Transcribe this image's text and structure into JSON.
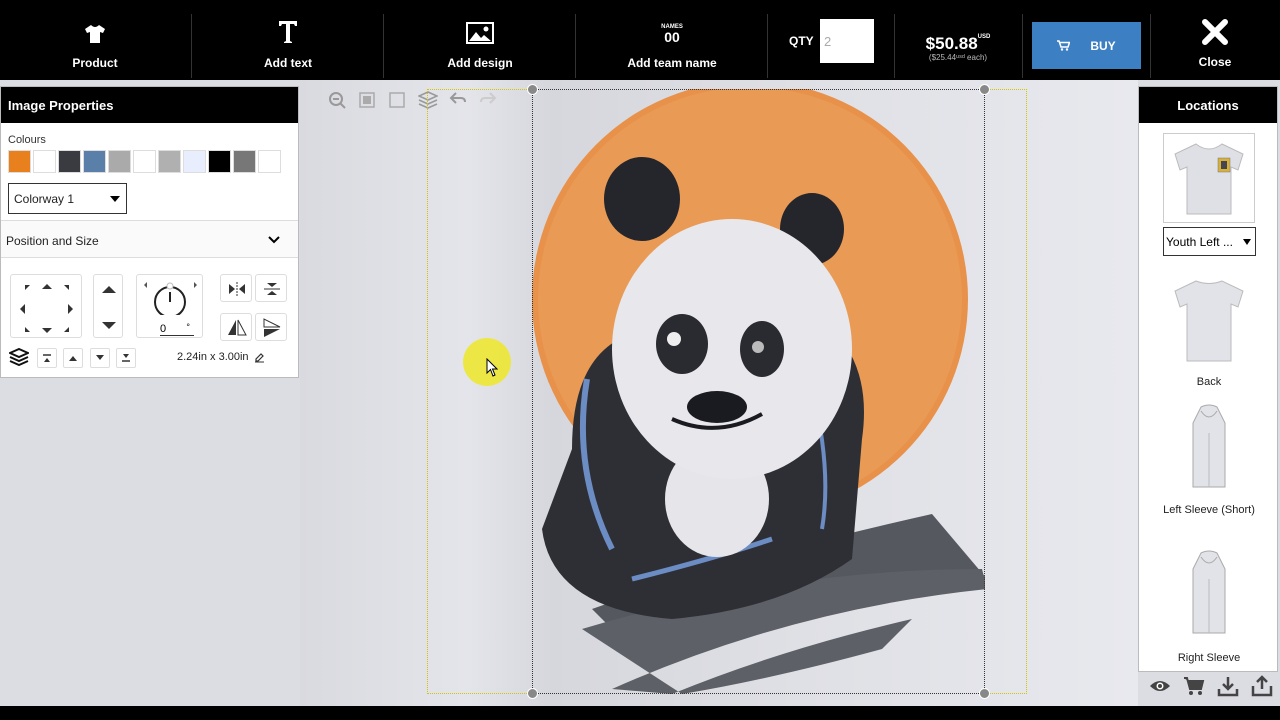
{
  "topbar": {
    "product_label": "Product",
    "add_text_label": "Add text",
    "add_design_label": "Add design",
    "add_team_name_label": "Add team name",
    "team_icon_text_top": "NAMES",
    "team_icon_text_bottom": "00",
    "qty_label": "QTY",
    "qty_value": "2",
    "price": "$50.88",
    "price_currency": "USD",
    "price_each": "($25.44ᵘˢᵈ each)",
    "buy_label": "BUY",
    "close_label": "Close"
  },
  "image_properties": {
    "title": "Image Properties",
    "colours_label": "Colours",
    "swatches": [
      "#e8801e",
      "#ffffff",
      "#3a3b40",
      "#5a7fa8",
      "#aaaaaa",
      "#ffffff",
      "#b0b0b0",
      "#e8eefe",
      "#000000",
      "#777777",
      "#ffffff"
    ],
    "colorway_value": "Colorway 1",
    "position_size_label": "Position and Size",
    "rotation_value": "0",
    "rotation_unit": "°",
    "size_text": "2.24in x 3.00in"
  },
  "locations": {
    "title": "Locations",
    "selected_location": "Youth Left ...",
    "items": [
      {
        "label": "Back"
      },
      {
        "label": "Left Sleeve (Short)"
      },
      {
        "label": "Right Sleeve"
      }
    ]
  },
  "colors": {
    "accent": "#3c80c3",
    "topbar": "#000000",
    "highlight": "#eee828"
  }
}
